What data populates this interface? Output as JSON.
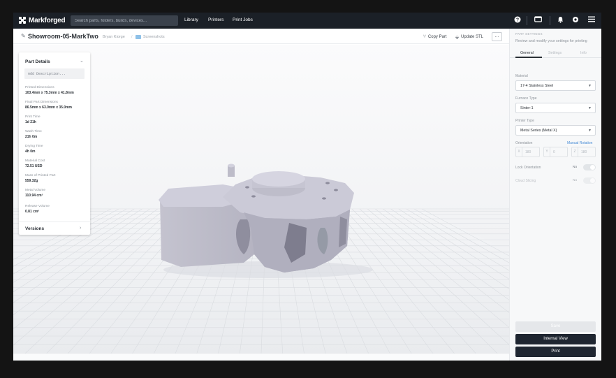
{
  "nav": {
    "brand": "Markforged",
    "search_placeholder": "Search parts, folders, builds, devices...",
    "links": [
      "Library",
      "Printers",
      "Print Jobs"
    ],
    "icons": [
      "help-icon",
      "display-icon",
      "bell-icon",
      "settings-icon",
      "menu-icon"
    ]
  },
  "header": {
    "part_name": "Showroom-05-MarkTwo",
    "owner": "Bryan Kiorge",
    "folder": "Screenshots",
    "copy_label": "Copy Part",
    "update_label": "Update STL",
    "more_label": "..."
  },
  "details": {
    "title": "Part Details",
    "description_placeholder": "Add Description...",
    "properties": [
      {
        "label": "Printed Dimensions",
        "value": "103.4mm x 75.3mm x 41.8mm"
      },
      {
        "label": "Final Part Dimensions",
        "value": "86.5mm x 63.0mm x 35.0mm"
      },
      {
        "label": "Print Time",
        "value": "1d 21h"
      },
      {
        "label": "Wash Time",
        "value": "21h 0m"
      },
      {
        "label": "Drying Time",
        "value": "4h 0m"
      },
      {
        "label": "Material Cost",
        "value": "72.51 USD"
      },
      {
        "label": "Mass of Printed Part",
        "value": "559.32g"
      },
      {
        "label": "Metal Volume",
        "value": "110.94 cm³"
      },
      {
        "label": "Release Volume",
        "value": "0.81 cm³"
      }
    ],
    "versions_label": "Versions"
  },
  "panel": {
    "heading": "PART SETTINGS",
    "subtitle": "Review and modify your settings for printing",
    "tabs": [
      "General",
      "Settings",
      "Info"
    ],
    "active_tab": "General",
    "material_label": "Material",
    "material_value": "17-4 Stainless Steel",
    "furnace_label": "Furnace Type",
    "furnace_value": "Sinter-1",
    "printer_label": "Printer Type",
    "printer_value": "Metal Series (Metal X)",
    "orientation_label": "Orientation",
    "manual_rotation_label": "Manual Rotation",
    "rotation": [
      {
        "axis": "X",
        "value": "180"
      },
      {
        "axis": "Y",
        "value": "0"
      },
      {
        "axis": "Z",
        "value": "180"
      }
    ],
    "lock_label": "Lock Orientation",
    "lock_value": "No",
    "cloud_label": "Cloud Slicing",
    "cloud_value": "No",
    "save_label": "Save",
    "internal_label": "Internal View",
    "print_label": "Print"
  },
  "colors": {
    "nav_bg": "#1b2027",
    "primary_button": "#1f2631",
    "link": "#4a8dd6",
    "part_fill": "#a9a8b6"
  }
}
